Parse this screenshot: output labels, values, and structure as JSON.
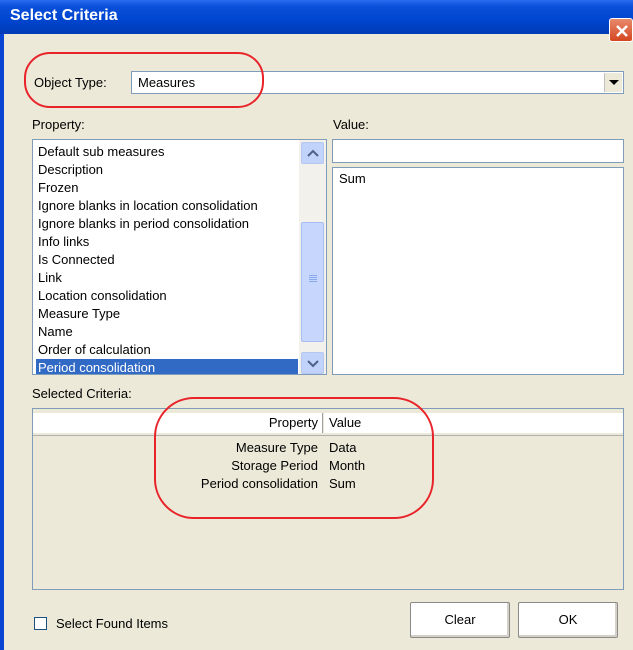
{
  "window": {
    "title": "Select Criteria"
  },
  "object_type": {
    "label": "Object Type:",
    "value": "Measures"
  },
  "property": {
    "label": "Property:",
    "items": [
      "Default sub measures",
      "Description",
      "Frozen",
      "Ignore blanks in location consolidation",
      "Ignore blanks in period consolidation",
      "Info links",
      "Is Connected",
      "Link",
      "Location consolidation",
      "Measure Type",
      "Name",
      "Order of calculation",
      "Period consolidation"
    ],
    "selected": "Period consolidation"
  },
  "value": {
    "label": "Value:",
    "input_value": "",
    "options": [
      "Sum"
    ]
  },
  "selected_criteria": {
    "label": "Selected Criteria:",
    "columns": [
      "Property",
      "Value"
    ],
    "rows": [
      {
        "property": "Measure Type",
        "value": "Data"
      },
      {
        "property": "Storage Period",
        "value": "Month"
      },
      {
        "property": "Period consolidation",
        "value": "Sum"
      }
    ]
  },
  "footer": {
    "checkbox_label": "Select Found Items",
    "checkbox_checked": false,
    "clear_label": "Clear",
    "ok_label": "OK"
  },
  "colors": {
    "titlebar": "#0045cf",
    "selection": "#316ac5",
    "highlight_ring": "#e8242a",
    "dialog_bg": "#ece9d8"
  }
}
